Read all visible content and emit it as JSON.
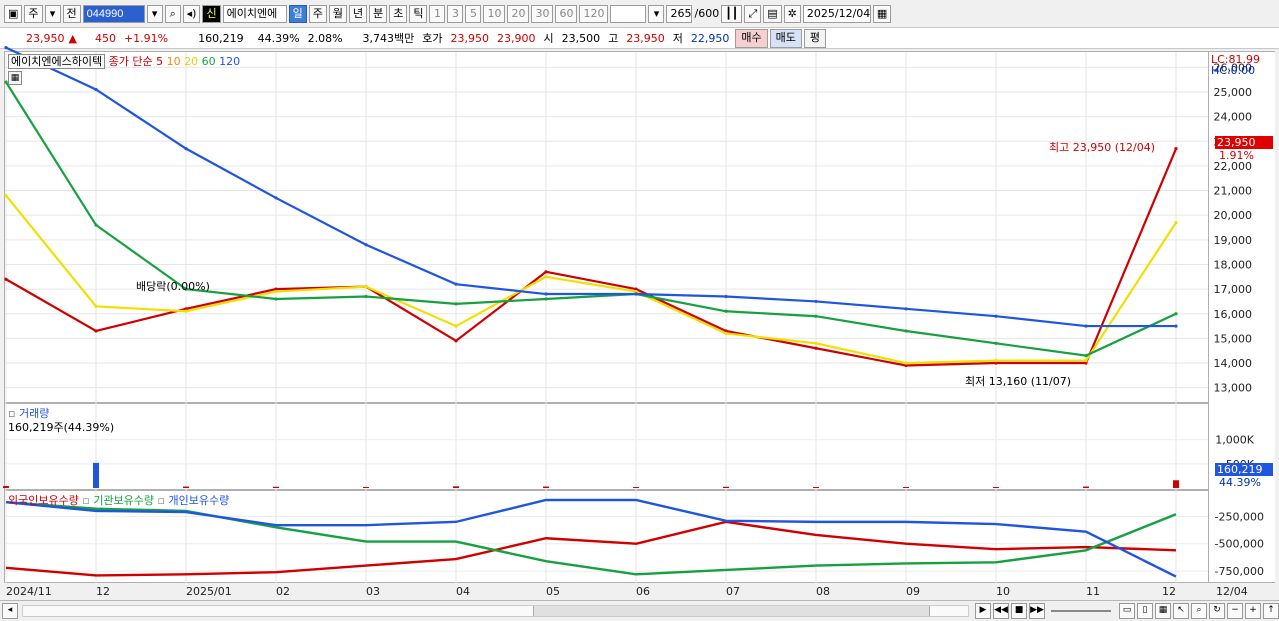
{
  "toolbar": {
    "period_unit": "주",
    "market_label": "전",
    "stock_code": "044990",
    "credit_flag": "신",
    "stock_name": "에이치엔에",
    "period_buttons": [
      "일",
      "주",
      "월",
      "년",
      "분",
      "초",
      "틱"
    ],
    "active_period": "일",
    "minute_buttons": [
      "1",
      "3",
      "5",
      "10",
      "20",
      "30",
      "60",
      "120"
    ],
    "count_display": "265",
    "count_total": "/600",
    "date": "2025/12/04"
  },
  "infobar": {
    "price": "23,950",
    "direction_icon": "▲",
    "change": "450",
    "change_pct": "+1.91%",
    "volume": "160,219",
    "volume_pct": "44.39%",
    "turnover_pct": "2.08%",
    "amount": "3,743백만",
    "bid_label": "호가",
    "ask_price": "23,950",
    "bid_price": "23,900",
    "open_label": "시",
    "open": "23,500",
    "high_label": "고",
    "high": "23,950",
    "low_label": "저",
    "low": "22,950",
    "buy_button": "매수",
    "sell_button": "매도",
    "eval_button": "평"
  },
  "price_panel": {
    "name_tag": "에이치엔에스하이텍",
    "ma_label": "종가 단순",
    "ma_periods": [
      "5",
      "10",
      "20",
      "60",
      "120"
    ],
    "ma_colors": [
      "#d00000",
      "#f08c00",
      "#f0e000",
      "#17a040",
      "#2055e0"
    ],
    "lc": "LC:81.99",
    "hc": "HC:0.00",
    "dividend_note": "배당락(0.00%)",
    "high_note": "최고 23,950 (12/04)",
    "low_note": "최저 13,160 (11/07)",
    "last_price_tag": "23,950",
    "last_pct_tag": "1.91%",
    "y_ticks": [
      "26,000",
      "25,000",
      "24,000",
      "23,000",
      "22,000",
      "21,000",
      "20,000",
      "19,000",
      "18,000",
      "17,000",
      "16,000",
      "15,000",
      "14,000",
      "13,000"
    ]
  },
  "volume_panel": {
    "title": "거래량",
    "value_text": "160,219주(44.39%)",
    "y_ticks": [
      "1,000K",
      "500K"
    ],
    "last_volume_tag": "160,219",
    "last_pct_tag": "44.39%"
  },
  "holding_panel": {
    "legend": [
      "외국인보유수량",
      "기관보유수량",
      "개인보유수량"
    ],
    "legend_colors": [
      "#d00000",
      "#17a040",
      "#2055e0"
    ],
    "y_ticks": [
      "-250,000",
      "-500,000",
      "-750,000"
    ]
  },
  "x_axis": {
    "labels": [
      "2024/11",
      "12",
      "2025/01",
      "02",
      "03",
      "04",
      "05",
      "06",
      "07",
      "08",
      "09",
      "10",
      "11",
      "12"
    ],
    "right_label": "12/04"
  },
  "chart_data": {
    "type": "line",
    "title": "에이치엔에스하이텍",
    "ylabel": "",
    "ylim": [
      12500,
      26500
    ],
    "x": [
      "2024/11",
      "12",
      "2025/01",
      "02",
      "03",
      "04",
      "05",
      "06",
      "07",
      "08",
      "09",
      "10",
      "11",
      "12/04"
    ],
    "series": [
      {
        "name": "5",
        "values": [
          17400,
          15300,
          16200,
          17000,
          17100,
          14900,
          17700,
          17000,
          15300,
          14600,
          13900,
          14000,
          14000,
          22700
        ]
      },
      {
        "name": "20",
        "values": [
          20800,
          16300,
          16100,
          16900,
          17100,
          15500,
          17500,
          16900,
          15200,
          14800,
          14000,
          14100,
          14100,
          19700
        ]
      },
      {
        "name": "60",
        "values": [
          25400,
          19600,
          17000,
          16600,
          16700,
          16400,
          16600,
          16800,
          16100,
          15900,
          15300,
          14800,
          14300,
          16000
        ]
      },
      {
        "name": "120",
        "values": [
          26800,
          25100,
          22700,
          20700,
          18800,
          17200,
          16800,
          16800,
          16700,
          16500,
          16200,
          15900,
          15500,
          15500
        ]
      }
    ],
    "volume_series": {
      "name": "거래량",
      "unit": "K",
      "values": [
        40,
        520,
        30,
        25,
        20,
        35,
        30,
        20,
        25,
        20,
        20,
        20,
        30,
        160
      ]
    },
    "holding_series": [
      {
        "name": "외국인보유수량",
        "values": [
          -720000,
          -790000,
          -780000,
          -760000,
          -700000,
          -640000,
          -450000,
          -500000,
          -300000,
          -420000,
          -500000,
          -550000,
          -530000,
          -560000
        ]
      },
      {
        "name": "기관보유수량",
        "values": [
          -120000,
          -180000,
          -200000,
          -350000,
          -480000,
          -480000,
          -660000,
          -780000,
          -740000,
          -700000,
          -680000,
          -670000,
          -560000,
          -230000
        ]
      },
      {
        "name": "개인보유수량",
        "values": [
          -120000,
          -200000,
          -210000,
          -330000,
          -330000,
          -300000,
          -100000,
          -100000,
          -290000,
          -300000,
          -300000,
          -320000,
          -390000,
          -800000
        ]
      }
    ]
  }
}
